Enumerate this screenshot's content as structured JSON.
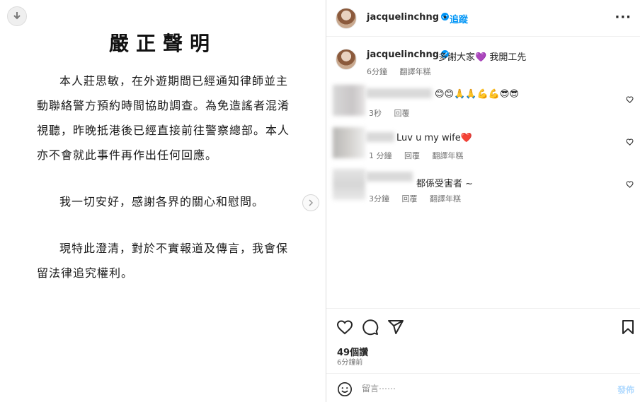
{
  "statement": {
    "title": "嚴正聲明",
    "paragraph1": "本人莊思敏，在外遊期間已經通知律師並主動聯絡警方預約時間協助調查。為免造謠者混淆視聽，昨晚抵港後已經直接前往警察總部。本人亦不會就此事件再作出任何回應。",
    "paragraph2": "我一切安好，感謝各界的關心和慰問。",
    "paragraph3": "現特此澄清，對於不實報道及傳言，我會保留法律追究權利。"
  },
  "header": {
    "username": "jacquelinchng",
    "dot": "•",
    "follow_label": "追蹤",
    "more_label": "···"
  },
  "caption": {
    "username": "jacquelinchng",
    "text": "多謝大家💜 我開工先",
    "time": "6分鐘",
    "translate": "翻譯年糕"
  },
  "comments": [
    {
      "text": "😊😊🙏🙏💪💪😎😎",
      "time": "3秒",
      "reply": "回覆",
      "translate": ""
    },
    {
      "text": "Luv u my wife❤️",
      "time": "1 分鐘",
      "reply": "回覆",
      "translate": "翻譯年糕"
    },
    {
      "text": "都係受害者 ~",
      "time": "3分鐘",
      "reply": "回覆",
      "translate": "翻譯年糕"
    }
  ],
  "likes": "49個讚",
  "posted": "6分鐘前",
  "comment_box": {
    "placeholder": "留言⋯⋯",
    "post_label": "發佈"
  },
  "colors": {
    "accent": "#0095f6",
    "text": "#262626",
    "muted": "#737373"
  },
  "icons": [
    "download-icon",
    "chevron-right-icon",
    "verified-icon",
    "more-icon",
    "heart-icon",
    "comment-icon",
    "share-icon",
    "bookmark-icon",
    "emoji-icon"
  ]
}
